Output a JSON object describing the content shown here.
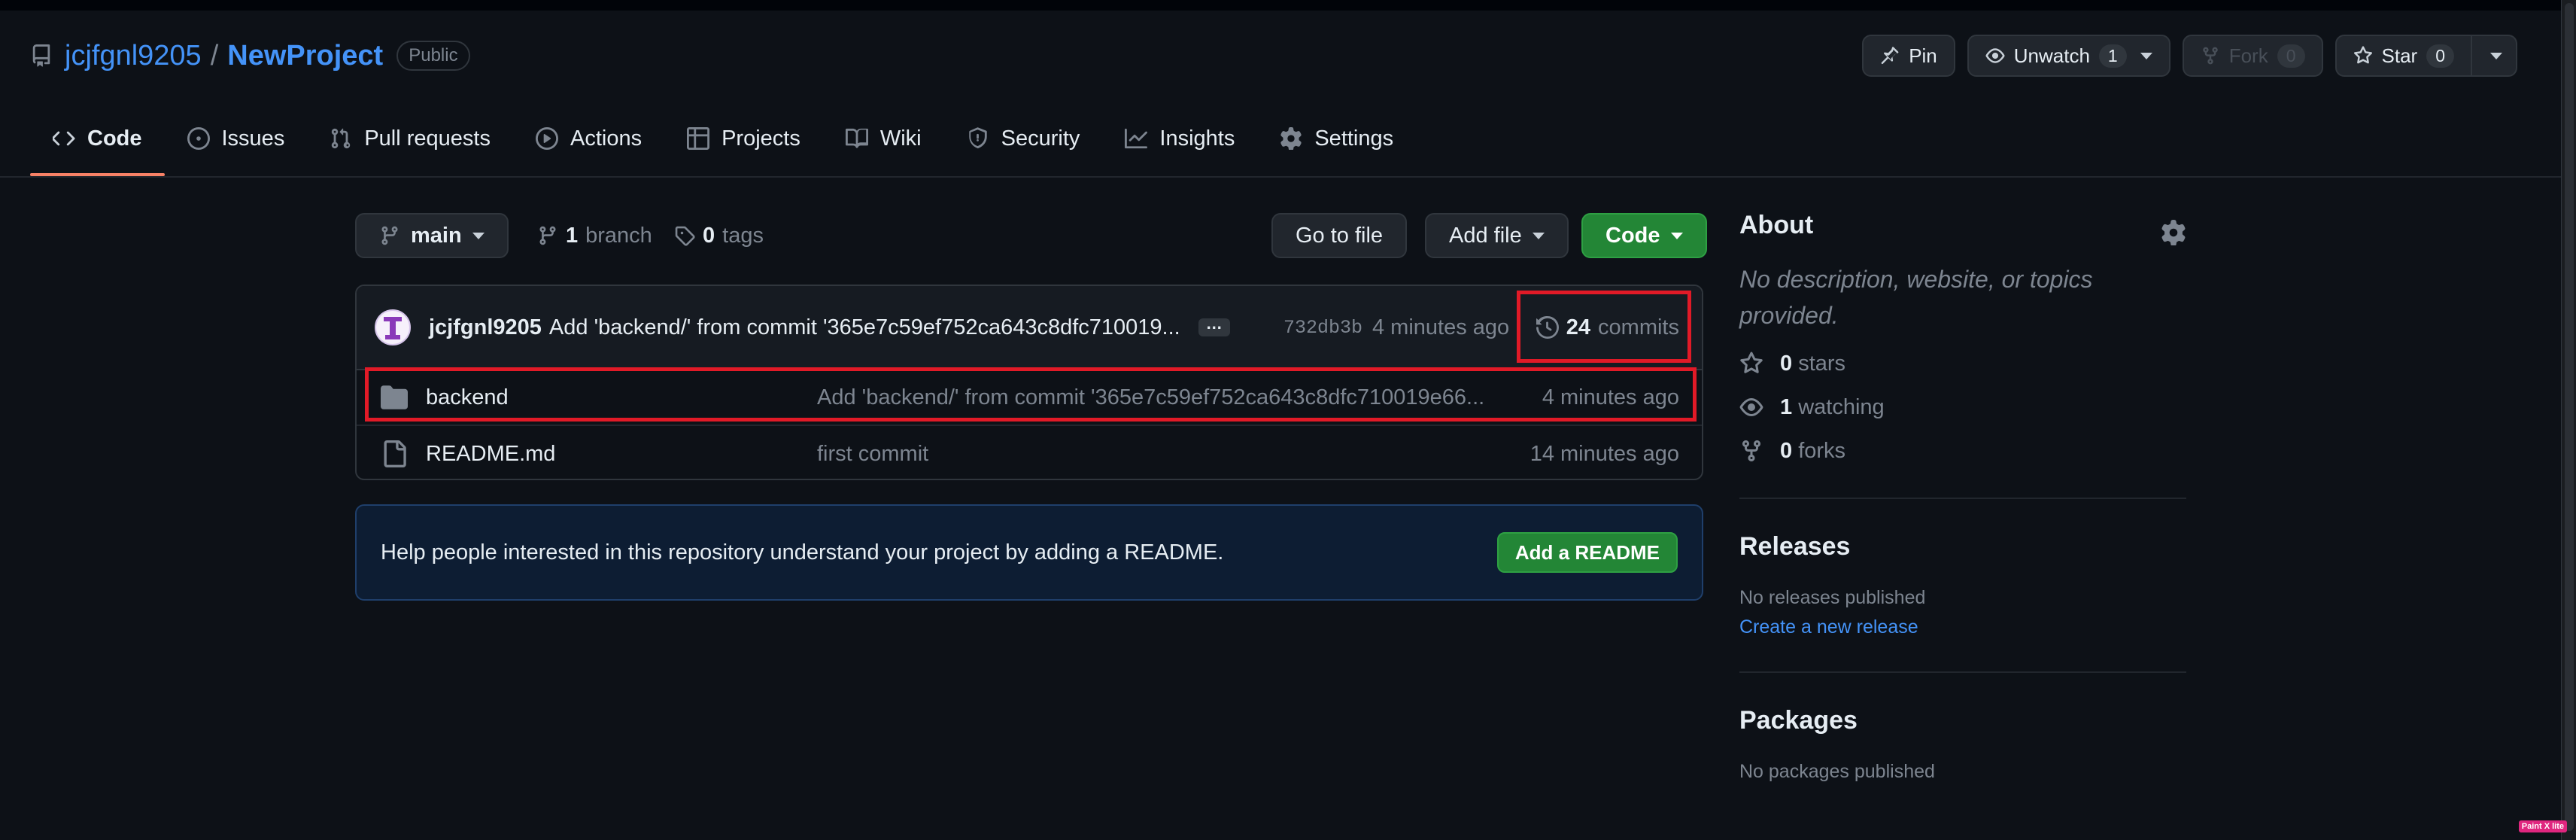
{
  "header": {
    "owner": "jcjfgnl9205",
    "separator": "/",
    "repo": "NewProject",
    "visibility": "Public",
    "actions": {
      "pin": "Pin",
      "unwatch": "Unwatch",
      "unwatch_count": "1",
      "fork": "Fork",
      "fork_count": "0",
      "star": "Star",
      "star_count": "0"
    }
  },
  "tabs": [
    {
      "label": "Code",
      "icon": "code-icon",
      "active": true
    },
    {
      "label": "Issues",
      "icon": "issue-icon"
    },
    {
      "label": "Pull requests",
      "icon": "pull-request-icon"
    },
    {
      "label": "Actions",
      "icon": "play-icon"
    },
    {
      "label": "Projects",
      "icon": "table-icon"
    },
    {
      "label": "Wiki",
      "icon": "book-icon"
    },
    {
      "label": "Security",
      "icon": "shield-icon"
    },
    {
      "label": "Insights",
      "icon": "graph-icon"
    },
    {
      "label": "Settings",
      "icon": "gear-icon"
    }
  ],
  "toolbar": {
    "branch": "main",
    "branch_count": "1",
    "branch_label": "branch",
    "tag_count": "0",
    "tag_label": "tags",
    "go_to_file": "Go to file",
    "add_file": "Add file",
    "code": "Code"
  },
  "commit": {
    "author": "jcjfgnl9205",
    "message": "Add 'backend/' from commit '365e7c59ef752ca643c8dfc710019...",
    "ellipsis": "…",
    "sha": "732db3b",
    "time": "4 minutes ago",
    "count": "24",
    "count_label": "commits"
  },
  "files": [
    {
      "name": "backend",
      "type": "folder",
      "message": "Add 'backend/' from commit '365e7c59ef752ca643c8dfc710019e66...",
      "time": "4 minutes ago"
    },
    {
      "name": "README.md",
      "type": "file",
      "message": "first commit",
      "time": "14 minutes ago"
    }
  ],
  "readme_banner": {
    "text": "Help people interested in this repository understand your project by adding a README.",
    "button": "Add a README"
  },
  "about": {
    "title": "About",
    "description": "No description, website, or topics provided.",
    "stars": "0",
    "stars_label": "stars",
    "watching": "1",
    "watching_label": "watching",
    "forks": "0",
    "forks_label": "forks"
  },
  "releases": {
    "title": "Releases",
    "none_text": "No releases published",
    "create_link": "Create a new release"
  },
  "packages": {
    "title": "Packages",
    "none_text": "No packages published"
  },
  "watermark": "Paint X lite",
  "colors": {
    "accent_link": "#4493f8",
    "tab_underline": "#f78166",
    "primary_button": "#238636",
    "highlight_box": "#e11a27"
  }
}
